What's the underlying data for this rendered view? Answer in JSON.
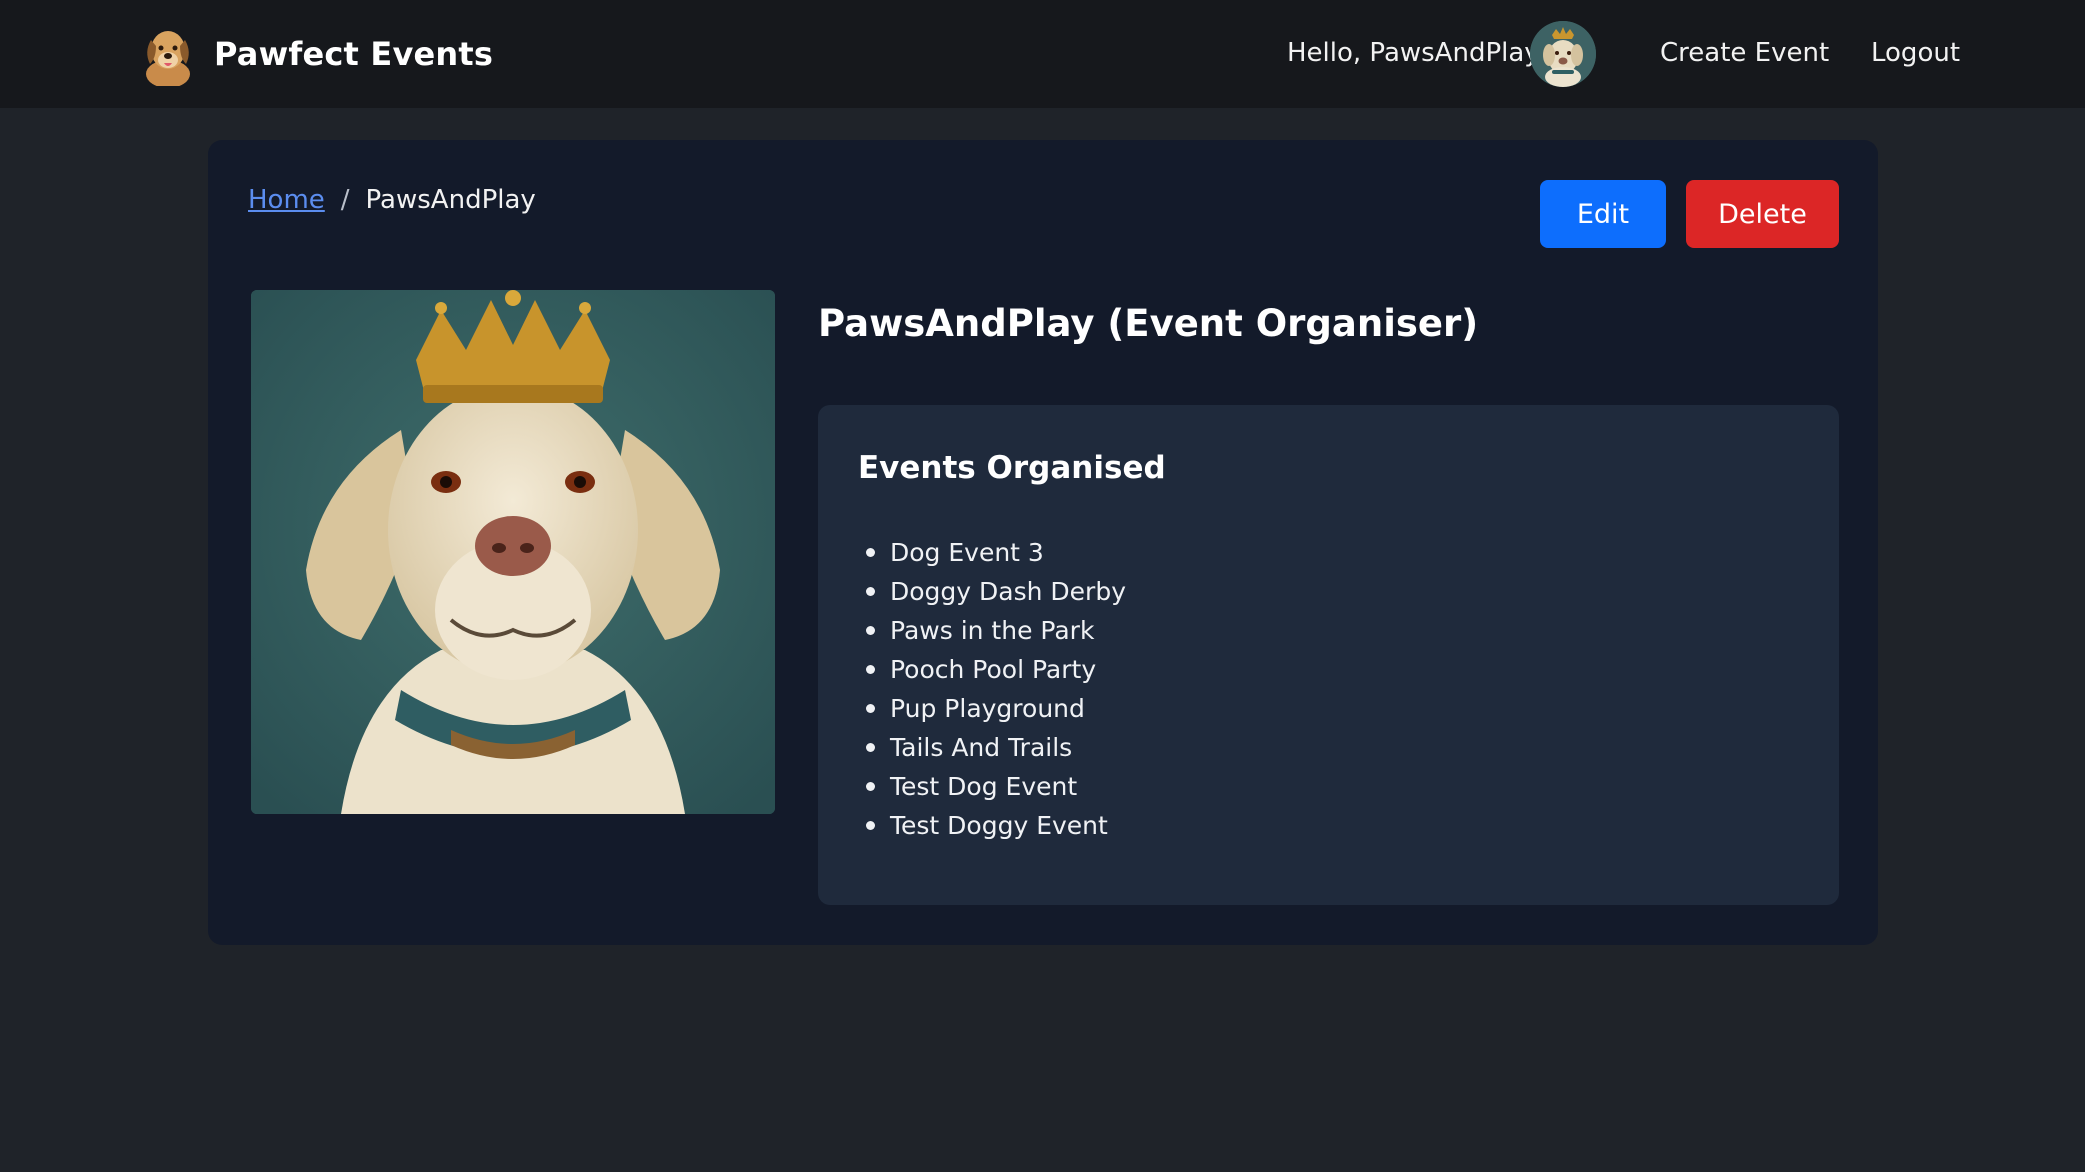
{
  "navbar": {
    "brand_name": "Pawfect Events",
    "greeting": "Hello, PawsAndPlay",
    "links": {
      "create_event": "Create Event",
      "logout": "Logout"
    },
    "background": "#16181c"
  },
  "breadcrumb": {
    "home": "Home",
    "separator": "/",
    "current": "PawsAndPlay"
  },
  "actions": {
    "edit_label": "Edit",
    "delete_label": "Delete",
    "edit_color": "#0d6efd",
    "delete_color": "#dc2626"
  },
  "profile": {
    "title": "PawsAndPlay (Event Organiser)",
    "photo_icon": "crowned-labrador-portrait"
  },
  "events_panel": {
    "heading": "Events Organised",
    "items": [
      "Dog Event 3",
      "Doggy Dash Derby",
      "Paws in the Park",
      "Pooch Pool Party",
      "Pup Playground",
      "Tails And Trails",
      "Test Dog Event",
      "Test Doggy Event"
    ]
  },
  "colors": {
    "page_background": "#1f2329",
    "card_background": "#131a2a",
    "panel_background": "#1f2a3c",
    "link": "#5b8def"
  }
}
